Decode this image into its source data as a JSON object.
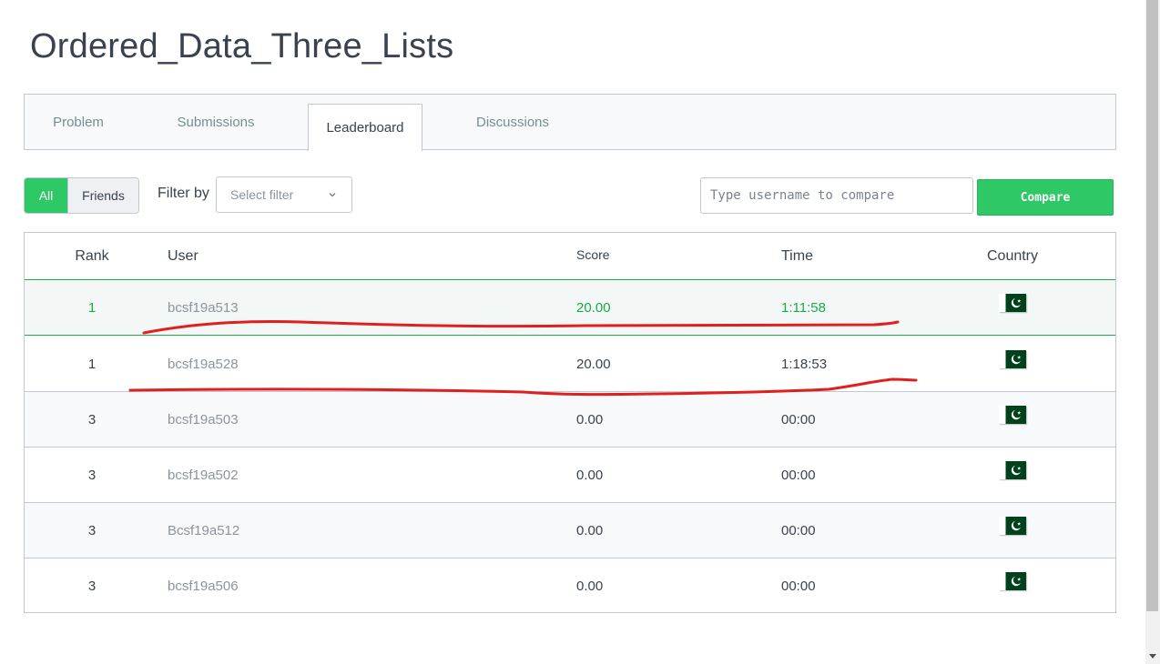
{
  "page": {
    "title": "Ordered_Data_Three_Lists"
  },
  "tabs": [
    {
      "label": "Problem",
      "active": false
    },
    {
      "label": "Submissions",
      "active": false
    },
    {
      "label": "Leaderboard",
      "active": true
    },
    {
      "label": "Discussions",
      "active": false
    }
  ],
  "toggle": {
    "all_label": "All",
    "friends_label": "Friends",
    "selected": "All"
  },
  "filter": {
    "label": "Filter by",
    "placeholder": "Select filter"
  },
  "compare": {
    "placeholder": "Type username to compare",
    "button_label": "Compare"
  },
  "leaderboard": {
    "columns": {
      "rank": "Rank",
      "user": "User",
      "score": "Score",
      "time": "Time",
      "country": "Country"
    },
    "rows": [
      {
        "rank": "1",
        "user": "bcsf19a513",
        "score": "20.00",
        "time": "1:11:58",
        "country": "Pakistan"
      },
      {
        "rank": "1",
        "user": "bcsf19a528",
        "score": "20.00",
        "time": "1:18:53",
        "country": "Pakistan"
      },
      {
        "rank": "3",
        "user": "bcsf19a503",
        "score": "0.00",
        "time": "00:00",
        "country": "Pakistan"
      },
      {
        "rank": "3",
        "user": "bcsf19a502",
        "score": "0.00",
        "time": "00:00",
        "country": "Pakistan"
      },
      {
        "rank": "3",
        "user": "Bcsf19a512",
        "score": "0.00",
        "time": "00:00",
        "country": "Pakistan"
      },
      {
        "rank": "3",
        "user": "bcsf19a506",
        "score": "0.00",
        "time": "00:00",
        "country": "Pakistan"
      }
    ]
  },
  "colors": {
    "accent_green": "#2ec866",
    "highlight_green": "#1ba94c",
    "annotation_red": "#e02020"
  },
  "icons": {
    "flag": "pakistan-flag-icon",
    "select": "chevron-down-icon"
  }
}
